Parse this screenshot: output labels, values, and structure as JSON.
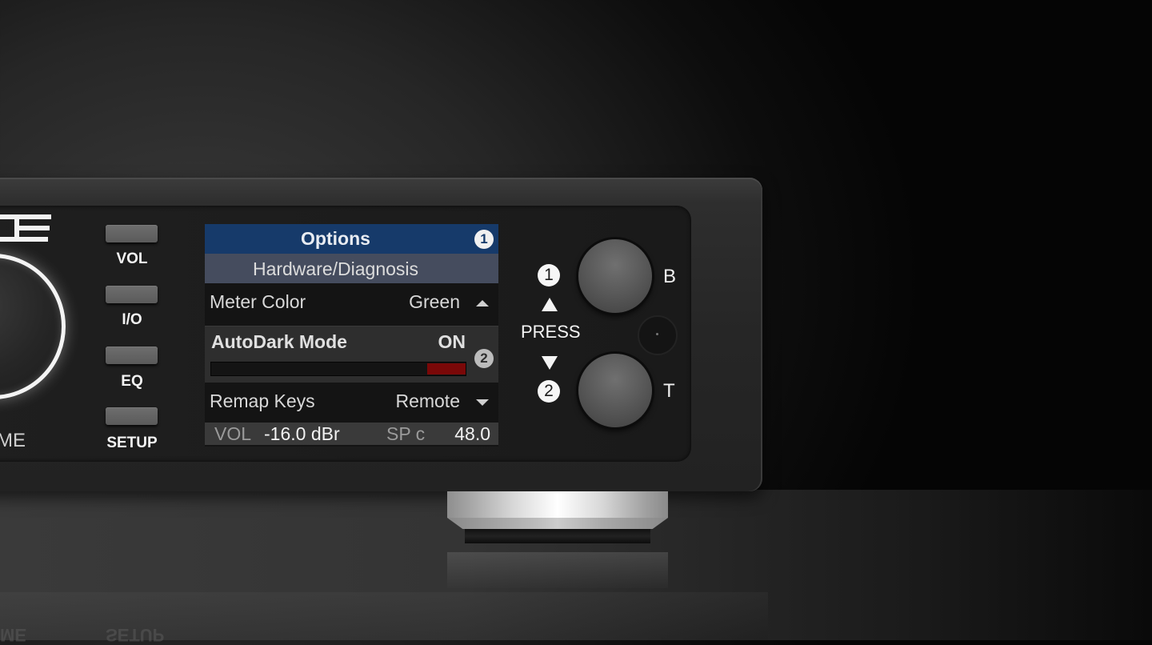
{
  "device": {
    "knob_label": "ME",
    "buttons": [
      {
        "label": "VOL"
      },
      {
        "label": "I/O"
      },
      {
        "label": "EQ"
      },
      {
        "label": "SETUP"
      }
    ]
  },
  "lcd": {
    "header": {
      "title": "Options",
      "badge": "1"
    },
    "subheader": "Hardware/Diagnosis",
    "rows": [
      {
        "label": "Meter Color",
        "value": "Green",
        "indicator": "up"
      },
      {
        "label": "Remap Keys",
        "value": "Remote",
        "indicator": "down"
      }
    ],
    "active_item": {
      "label": "AutoDark Mode",
      "value": "ON",
      "badge": "2",
      "bar_fill_fraction": 0.15,
      "bar_color": "#7a0808"
    },
    "status": {
      "vol_label": "VOL",
      "vol_value": "-16.0 dBr",
      "sp_label": "SP c",
      "sp_value": "48.0"
    },
    "colors": {
      "header_bg": "#163a6a",
      "subheader_bg": "#454c5e"
    }
  },
  "controls": {
    "press_label": "PRESS",
    "num_top": "1",
    "num_bottom": "2",
    "button_top_letter": "B",
    "button_bottom_letter": "T"
  },
  "reflection": {
    "left_text": "ME",
    "right_text": "SETUP"
  }
}
